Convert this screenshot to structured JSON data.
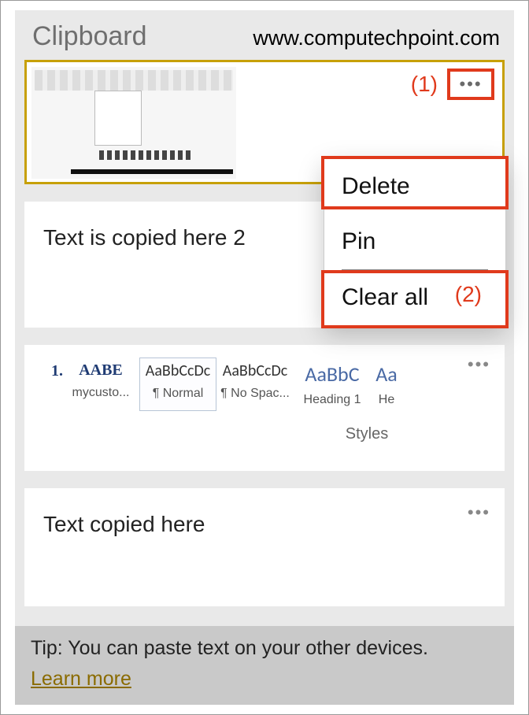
{
  "header": {
    "title": "Clipboard",
    "watermark": "www.computechpoint.com"
  },
  "annotations": {
    "callout1": "(1)",
    "callout2": "(2)"
  },
  "context_menu": {
    "delete": "Delete",
    "pin": "Pin",
    "clear_all": "Clear all"
  },
  "items": {
    "item2_text": "Text is copied here 2",
    "item4_text": "Text copied here",
    "styles_gallery": {
      "prefix": "1.",
      "tiles": [
        {
          "sample": "AABE",
          "label": "mycusto..."
        },
        {
          "sample": "AaBbCcDc",
          "label": "¶ Normal"
        },
        {
          "sample": "AaBbCcDc",
          "label": "¶ No Spac..."
        },
        {
          "sample": "AaBbC",
          "label": "Heading 1"
        },
        {
          "sample": "Aa",
          "label": "He"
        }
      ],
      "caption": "Styles"
    }
  },
  "tip": {
    "text": "Tip: You can paste text on your other devices.",
    "link": "Learn more"
  }
}
